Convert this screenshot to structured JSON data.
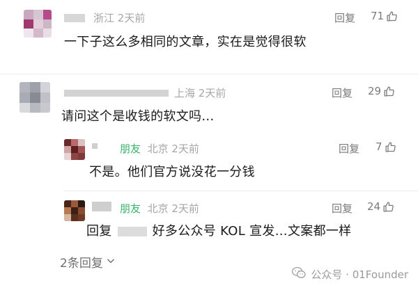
{
  "comments": [
    {
      "location": "浙江",
      "time": "2天前",
      "reply_label": "回复",
      "likes": "71",
      "text": "一下子这么多相同的文章，实在是觉得很软"
    },
    {
      "location": "上海",
      "time": "2天前",
      "reply_label": "回复",
      "likes": "29",
      "text": "请问这个是收钱的软文吗…"
    }
  ],
  "replies": [
    {
      "tag": "朋友",
      "location": "北京",
      "time": "2天前",
      "reply_label": "回复",
      "likes": "7",
      "text": "不是。他们官方说没花一分钱"
    },
    {
      "tag": "朋友",
      "location": "北京",
      "time": "2天前",
      "reply_label": "回复",
      "likes": "24",
      "text_prefix": "回复",
      "text": "好多公众号 KOL 宣发…文案都一样"
    }
  ],
  "more_replies": "2条回复",
  "watermark": "公众号 · 01Founder",
  "icons": {
    "like": "thumbs-up-icon",
    "more": "chevron-down-icon",
    "watermark": "wechat-icon"
  },
  "colors": {
    "friend_tag": "#38b36a",
    "meta": "#a6a6a6",
    "text": "#1a1a1a"
  }
}
